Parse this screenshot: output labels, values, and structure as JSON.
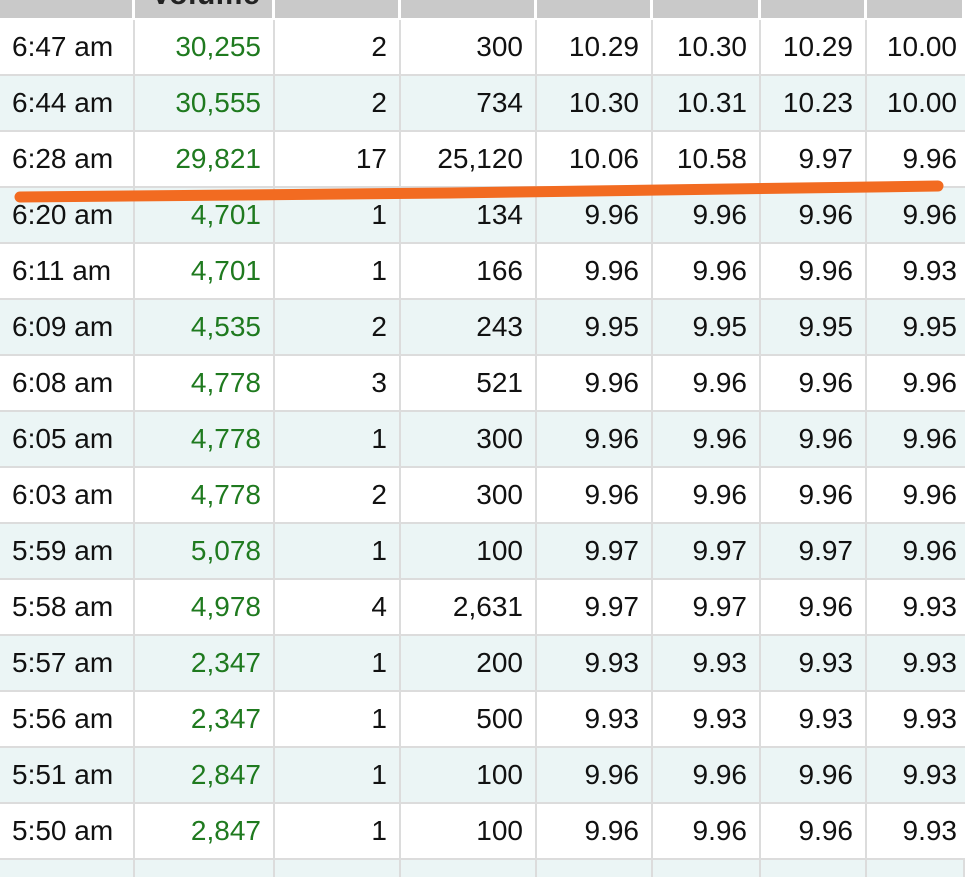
{
  "header": {
    "volume_label": "Volume"
  },
  "rows": [
    {
      "time": "6:47 am",
      "volume": "30,255",
      "trades": "2",
      "shares": "300",
      "open": "10.29",
      "high": "10.30",
      "low": "10.29",
      "close": "10.00"
    },
    {
      "time": "6:44 am",
      "volume": "30,555",
      "trades": "2",
      "shares": "734",
      "open": "10.30",
      "high": "10.31",
      "low": "10.23",
      "close": "10.00"
    },
    {
      "time": "6:28 am",
      "volume": "29,821",
      "trades": "17",
      "shares": "25,120",
      "open": "10.06",
      "high": "10.58",
      "low": "9.97",
      "close": "9.96"
    },
    {
      "time": "6:20 am",
      "volume": "4,701",
      "trades": "1",
      "shares": "134",
      "open": "9.96",
      "high": "9.96",
      "low": "9.96",
      "close": "9.96"
    },
    {
      "time": "6:11 am",
      "volume": "4,701",
      "trades": "1",
      "shares": "166",
      "open": "9.96",
      "high": "9.96",
      "low": "9.96",
      "close": "9.93"
    },
    {
      "time": "6:09 am",
      "volume": "4,535",
      "trades": "2",
      "shares": "243",
      "open": "9.95",
      "high": "9.95",
      "low": "9.95",
      "close": "9.95"
    },
    {
      "time": "6:08 am",
      "volume": "4,778",
      "trades": "3",
      "shares": "521",
      "open": "9.96",
      "high": "9.96",
      "low": "9.96",
      "close": "9.96"
    },
    {
      "time": "6:05 am",
      "volume": "4,778",
      "trades": "1",
      "shares": "300",
      "open": "9.96",
      "high": "9.96",
      "low": "9.96",
      "close": "9.96"
    },
    {
      "time": "6:03 am",
      "volume": "4,778",
      "trades": "2",
      "shares": "300",
      "open": "9.96",
      "high": "9.96",
      "low": "9.96",
      "close": "9.96"
    },
    {
      "time": "5:59 am",
      "volume": "5,078",
      "trades": "1",
      "shares": "100",
      "open": "9.97",
      "high": "9.97",
      "low": "9.97",
      "close": "9.96"
    },
    {
      "time": "5:58 am",
      "volume": "4,978",
      "trades": "4",
      "shares": "2,631",
      "open": "9.97",
      "high": "9.97",
      "low": "9.96",
      "close": "9.93"
    },
    {
      "time": "5:57 am",
      "volume": "2,347",
      "trades": "1",
      "shares": "200",
      "open": "9.93",
      "high": "9.93",
      "low": "9.93",
      "close": "9.93"
    },
    {
      "time": "5:56 am",
      "volume": "2,347",
      "trades": "1",
      "shares": "500",
      "open": "9.93",
      "high": "9.93",
      "low": "9.93",
      "close": "9.93"
    },
    {
      "time": "5:51 am",
      "volume": "2,847",
      "trades": "1",
      "shares": "100",
      "open": "9.96",
      "high": "9.96",
      "low": "9.96",
      "close": "9.93"
    },
    {
      "time": "5:50 am",
      "volume": "2,847",
      "trades": "1",
      "shares": "100",
      "open": "9.96",
      "high": "9.96",
      "low": "9.96",
      "close": "9.93"
    }
  ],
  "colors": {
    "volume_text": "#1f7a1f",
    "annotation_line": "#f26b21",
    "alt_row": "#ebf5f5"
  }
}
